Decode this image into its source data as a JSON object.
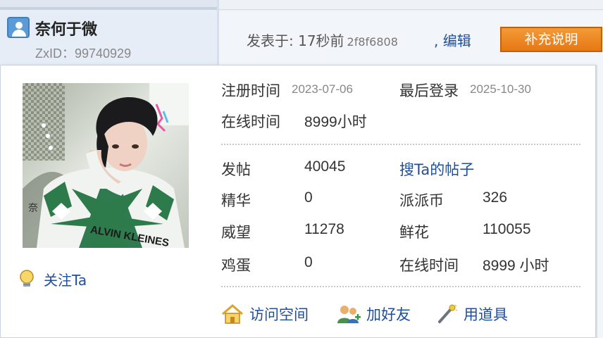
{
  "author": {
    "name": "奈何于微",
    "id_text": "ZxID：99740929"
  },
  "post": {
    "meta_text": "发表于: 17秒前",
    "hash": "2f8f6808",
    "edit_text": ", 编辑",
    "supplement_label": "补充说明"
  },
  "card": {
    "follow_label": "关注Ta",
    "register_label": "注册时间",
    "register_date": "2023-07-06",
    "last_login_label": "最后登录",
    "last_login_date": "2025-10-30",
    "online_label": "在线时间",
    "online_value": "8999小时",
    "stats": {
      "posts_label": "发帖",
      "posts_value": "40045",
      "search_posts_link": "搜Ta的帖子",
      "digest_label": "精华",
      "digest_value": "0",
      "coins_label": "派派币",
      "coins_value": "326",
      "prestige_label": "威望",
      "prestige_value": "11278",
      "flowers_label": "鲜花",
      "flowers_value": "110055",
      "eggs_label": "鸡蛋",
      "eggs_value": "0",
      "online2_label": "在线时间",
      "online2_value": "8999 小时"
    },
    "actions": {
      "visit_space": "访问空间",
      "add_friend": "加好友",
      "use_item": "用道具"
    },
    "avatar_text": "ALVIN KLEINES"
  },
  "colors": {
    "link": "#1f4f9a",
    "supplement_bg": "#e67812",
    "muted": "#888888"
  }
}
